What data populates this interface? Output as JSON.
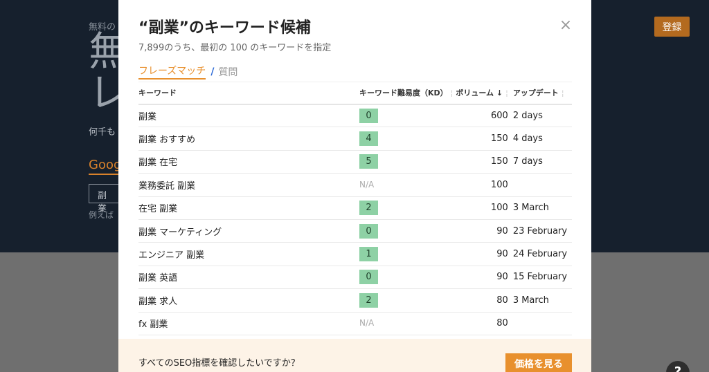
{
  "background": {
    "small_text": "無料の",
    "big_text": "無",
    "big_text2": "レ",
    "sub_text": "何千も",
    "google_tab": "Goog",
    "input_value": "副業",
    "example_text": "例えば",
    "register_label": "登録",
    "help_label": "?"
  },
  "modal": {
    "title": "“副業”のキーワード候補",
    "subtitle": "7,899のうち、最初の 100 のキーワードを指定",
    "close_label": "×",
    "tabs": {
      "phrase_match": "フレーズマッチ",
      "separator": "/",
      "questions": "質問"
    },
    "table": {
      "headers": {
        "keyword": "キーワード",
        "kd": "キーワード難易度（KD）",
        "volume": "ボリューム ↓",
        "update": "アップデート"
      },
      "rows": [
        {
          "keyword": "副業",
          "kd": "0",
          "volume": "600",
          "update": "2 days"
        },
        {
          "keyword": "副業 おすすめ",
          "kd": "4",
          "volume": "150",
          "update": "4 days"
        },
        {
          "keyword": "副業 在宅",
          "kd": "5",
          "volume": "150",
          "update": "7 days"
        },
        {
          "keyword": "業務委託 副業",
          "kd": "N/A",
          "volume": "100",
          "update": ""
        },
        {
          "keyword": "在宅 副業",
          "kd": "2",
          "volume": "100",
          "update": "3 March"
        },
        {
          "keyword": "副業 マーケティング",
          "kd": "0",
          "volume": "90",
          "update": "23 February"
        },
        {
          "keyword": "エンジニア 副業",
          "kd": "1",
          "volume": "90",
          "update": "24 February"
        },
        {
          "keyword": "副業 英語",
          "kd": "0",
          "volume": "90",
          "update": "15 February"
        },
        {
          "keyword": "副業 求人",
          "kd": "2",
          "volume": "80",
          "update": "3 March"
        },
        {
          "keyword": "fx 副業",
          "kd": "N/A",
          "volume": "80",
          "update": ""
        }
      ]
    },
    "footer": {
      "question": "すべてのSEO指標を確認したいですか？",
      "price_button": "価格を見る"
    }
  },
  "colors": {
    "accent": "#e8902e",
    "kd_badge": "#8ed1a5",
    "dark_header": "#16202d"
  }
}
